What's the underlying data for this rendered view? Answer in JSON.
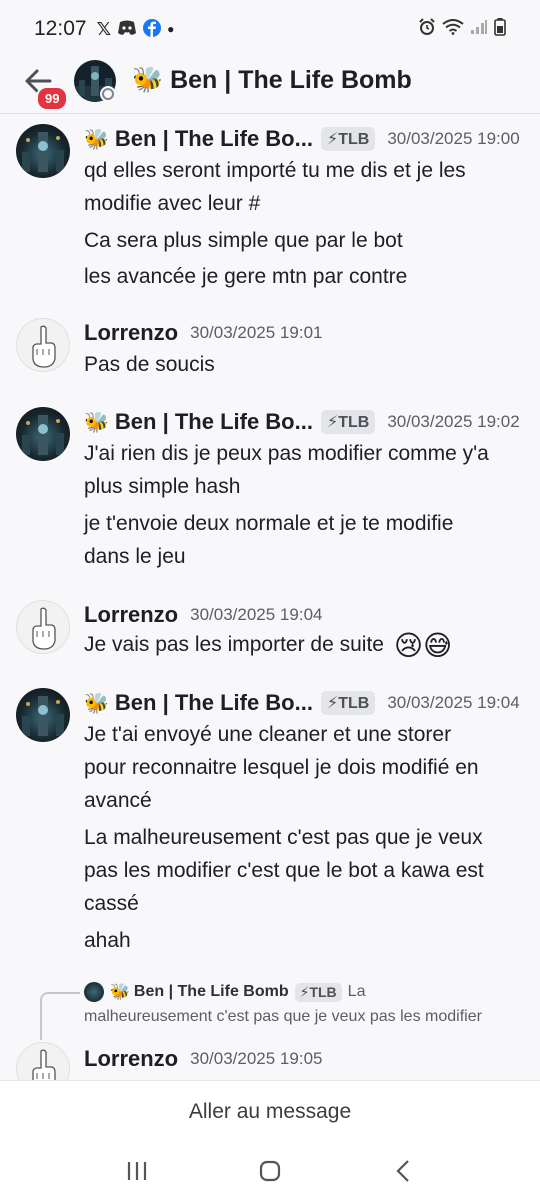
{
  "status_bar": {
    "time": "12:07",
    "icons_left": [
      "x-icon",
      "discord-icon",
      "facebook-icon",
      "dot-icon"
    ],
    "icons_right": [
      "alarm-icon",
      "wifi-icon",
      "signal-icon",
      "battery-icon"
    ]
  },
  "header": {
    "badge": "99",
    "title": "🐝 Ben | The Life Bomb"
  },
  "messages": [
    {
      "author": "Ben | The Life Bo...",
      "tag": "⚡TLB",
      "time": "30/03/2025 19:00",
      "lines": [
        "qd elles seront importé tu me dis et je les",
        "modifie avec leur #",
        "Ca sera plus simple que par le bot",
        "les avancée je gere mtn par contre"
      ]
    },
    {
      "author": "Lorrenzo",
      "time": "30/03/2025 19:01",
      "lines": [
        "Pas de soucis"
      ]
    },
    {
      "author": "Ben | The Life Bo...",
      "tag": "⚡TLB",
      "time": "30/03/2025 19:02",
      "lines": [
        "J'ai rien dis je peux pas modifier comme y'a",
        "plus simple hash",
        "je t'envoie deux normale et je te modifie",
        "dans le jeu"
      ]
    },
    {
      "author": "Lorrenzo",
      "time": "30/03/2025 19:04",
      "lines": [
        "Je vais pas les importer de suite"
      ],
      "emojis": "😢😅"
    },
    {
      "author": "Ben | The Life Bo...",
      "tag": "⚡TLB",
      "time": "30/03/2025 19:04",
      "lines": [
        "Je t'ai envoyé une cleaner et une storer",
        "pour reconnaitre lesquel je dois modifié en",
        "avancé",
        "La malheureusement c'est pas que je veux",
        "pas les modifier c'est que le bot a kawa est",
        "cassé",
        "ahah"
      ]
    },
    {
      "author": "Lorrenzo",
      "time": "30/03/2025 19:05",
      "lines": []
    }
  ],
  "reply": {
    "author": "Ben | The Life Bomb",
    "tag": "⚡TLB",
    "text_start": "La",
    "text_rest": "malheureusement c'est pas que je veux pas les modifier"
  },
  "jump_to_message": "Aller au message"
}
